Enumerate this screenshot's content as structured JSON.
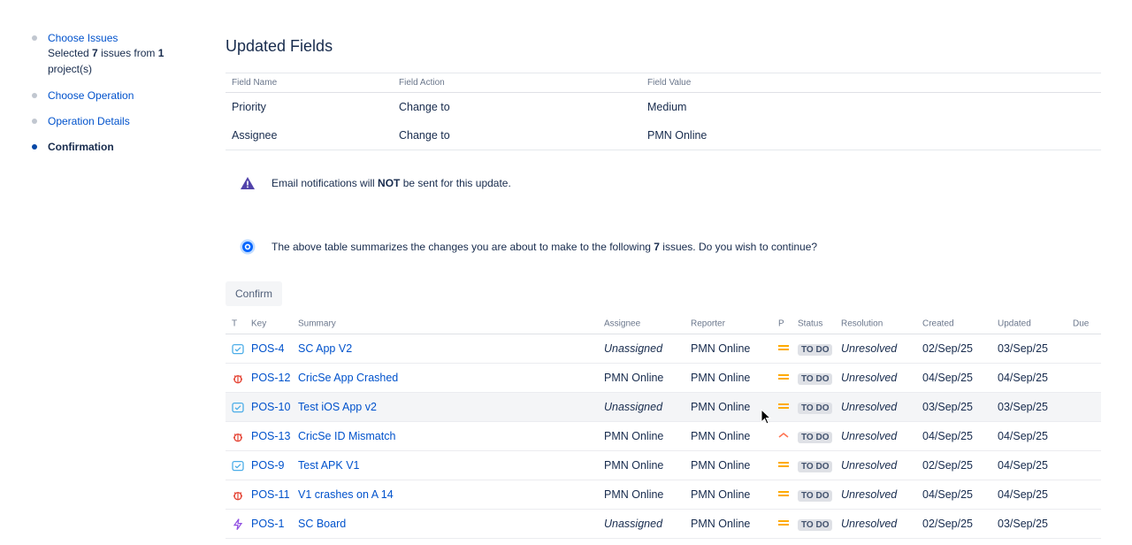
{
  "sidebar": {
    "steps": [
      {
        "label": "Choose Issues",
        "sub_prefix": "Selected ",
        "sub_count": "7",
        "sub_mid": " issues from ",
        "sub_projects": "1",
        "sub_suffix": " project(s)"
      },
      {
        "label": "Choose Operation"
      },
      {
        "label": "Operation Details"
      },
      {
        "label": "Confirmation"
      }
    ]
  },
  "main": {
    "title": "Updated Fields",
    "fields_table": {
      "headers": [
        "Field Name",
        "Field Action",
        "Field Value"
      ],
      "rows": [
        [
          "Priority",
          "Change to",
          "Medium"
        ],
        [
          "Assignee",
          "Change to",
          "PMN Online"
        ]
      ]
    },
    "email_notice": {
      "prefix": "Email notifications will ",
      "bold": "NOT",
      "suffix": " be sent for this update."
    },
    "summary_notice": {
      "prefix": "The above table summarizes the changes you are about to make to the following ",
      "count": "7",
      "suffix": " issues. Do you wish to continue?"
    },
    "confirm_label": "Confirm",
    "issues_table": {
      "headers": {
        "type": "T",
        "key": "Key",
        "summary": "Summary",
        "assignee": "Assignee",
        "reporter": "Reporter",
        "priority": "P",
        "status": "Status",
        "resolution": "Resolution",
        "created": "Created",
        "updated": "Updated",
        "due": "Due"
      },
      "rows": [
        {
          "type_icon": "task-icon",
          "key": "POS-4",
          "summary": "SC App V2",
          "assignee": "Unassigned",
          "reporter": "PMN Online",
          "priority_icon": "priority-medium-icon",
          "status": "TO DO",
          "resolution": "Unresolved",
          "created": "02/Sep/25",
          "updated": "03/Sep/25",
          "due": ""
        },
        {
          "type_icon": "bug-icon",
          "key": "POS-12",
          "summary": "CricSe App Crashed",
          "assignee": "PMN Online",
          "reporter": "PMN Online",
          "priority_icon": "priority-medium-icon",
          "status": "TO DO",
          "resolution": "Unresolved",
          "created": "04/Sep/25",
          "updated": "04/Sep/25",
          "due": ""
        },
        {
          "type_icon": "task-icon",
          "key": "POS-10",
          "summary": "Test iOS App v2",
          "assignee": "Unassigned",
          "reporter": "PMN Online",
          "priority_icon": "priority-medium-icon",
          "status": "TO DO",
          "resolution": "Unresolved",
          "created": "03/Sep/25",
          "updated": "03/Sep/25",
          "due": ""
        },
        {
          "type_icon": "bug-icon",
          "key": "POS-13",
          "summary": "CricSe ID Mismatch",
          "assignee": "PMN Online",
          "reporter": "PMN Online",
          "priority_icon": "priority-high-icon",
          "status": "TO DO",
          "resolution": "Unresolved",
          "created": "04/Sep/25",
          "updated": "04/Sep/25",
          "due": ""
        },
        {
          "type_icon": "task-icon",
          "key": "POS-9",
          "summary": "Test APK V1",
          "assignee": "PMN Online",
          "reporter": "PMN Online",
          "priority_icon": "priority-medium-icon",
          "status": "TO DO",
          "resolution": "Unresolved",
          "created": "02/Sep/25",
          "updated": "04/Sep/25",
          "due": ""
        },
        {
          "type_icon": "bug-icon",
          "key": "POS-11",
          "summary": "V1 crashes on A 14",
          "assignee": "PMN Online",
          "reporter": "PMN Online",
          "priority_icon": "priority-medium-icon",
          "status": "TO DO",
          "resolution": "Unresolved",
          "created": "04/Sep/25",
          "updated": "04/Sep/25",
          "due": ""
        },
        {
          "type_icon": "epic-icon",
          "key": "POS-1",
          "summary": "SC Board",
          "assignee": "Unassigned",
          "reporter": "PMN Online",
          "priority_icon": "priority-medium-icon",
          "status": "TO DO",
          "resolution": "Unresolved",
          "created": "02/Sep/25",
          "updated": "03/Sep/25",
          "due": ""
        }
      ]
    }
  },
  "colors": {
    "link": "#0052cc",
    "text": "#172b4d",
    "warning": "#5243aa",
    "info": "#0065ff",
    "priority_medium": "#ffab00",
    "priority_high": "#ff7452",
    "bug": "#e5493a",
    "task": "#4bade8",
    "epic": "#904ee2"
  }
}
